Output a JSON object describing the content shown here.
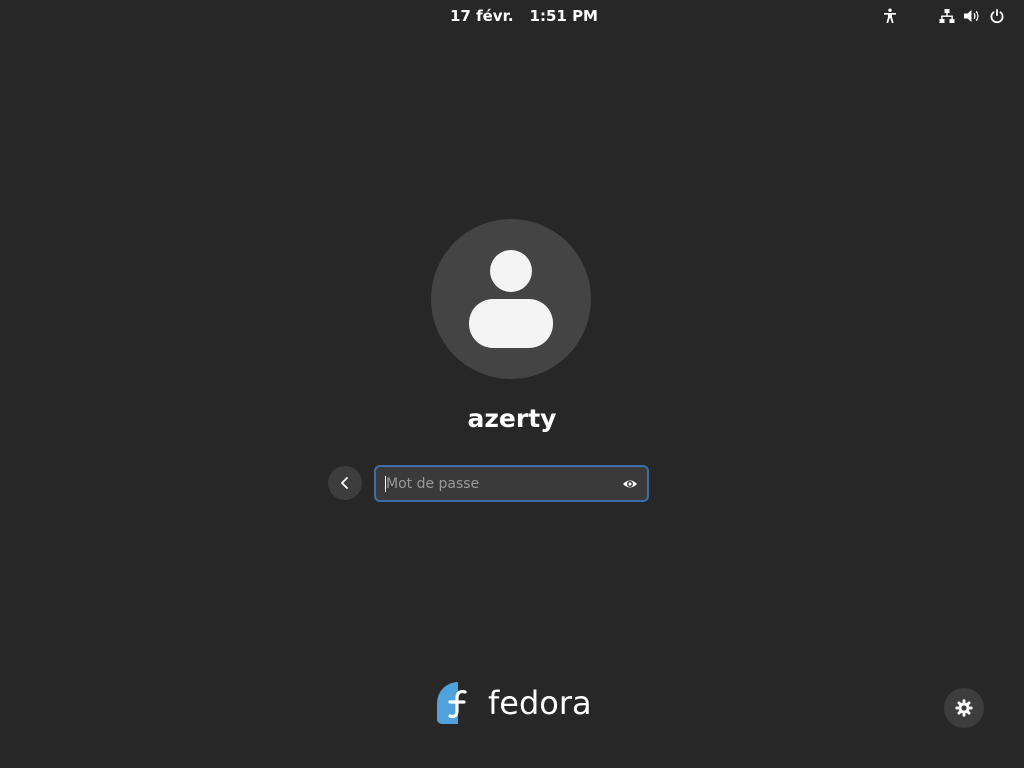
{
  "top_bar": {
    "date": "17 févr.",
    "time": "1:51 PM",
    "icons": [
      "accessibility-icon",
      "network-wired-icon",
      "volume-icon",
      "power-icon"
    ]
  },
  "user": {
    "name": "azerty",
    "avatar_icon": "user-avatar-icon"
  },
  "login": {
    "password_placeholder": "Mot de passe",
    "password_value": "",
    "back_icon": "chevron-left-icon",
    "reveal_icon": "eye-icon"
  },
  "branding": {
    "logo_text": "fedora",
    "logo_color": "#51a2da"
  },
  "settings_icon": "gear-icon",
  "colors": {
    "background": "#272727",
    "input_border": "#3e6ea6",
    "avatar_bg": "#444444"
  }
}
